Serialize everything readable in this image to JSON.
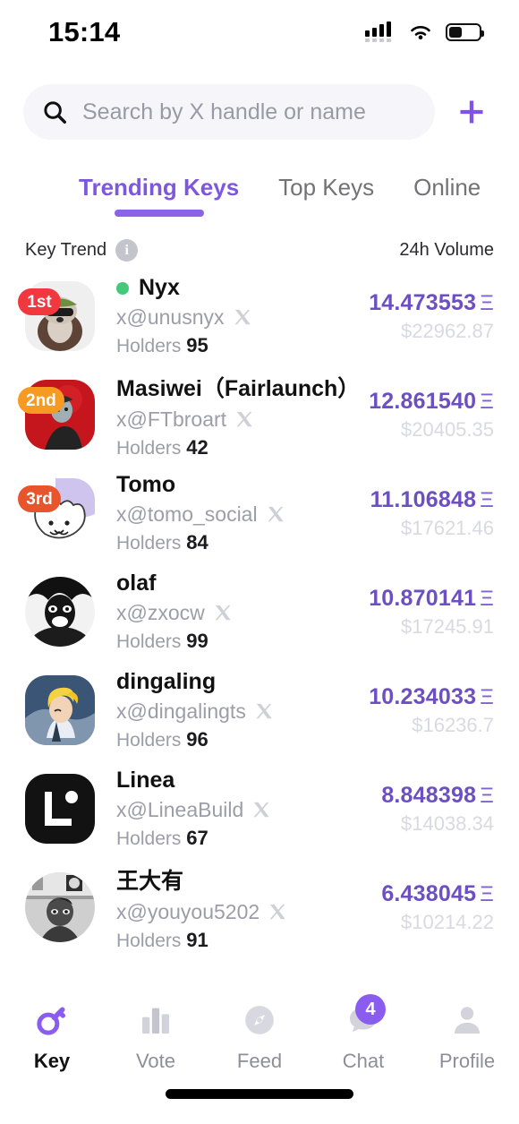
{
  "status_bar": {
    "time": "15:14",
    "cellular_icon": "cellular-signal-icon",
    "wifi_icon": "wifi-icon",
    "battery_icon": "battery-icon",
    "battery_level_pct": 45
  },
  "search": {
    "placeholder": "Search by X handle or name",
    "value": "",
    "icon": "search-icon",
    "add_icon": "plus-icon"
  },
  "tabs": [
    {
      "label": "Trending Keys",
      "active": true
    },
    {
      "label": "Top Keys",
      "active": false
    },
    {
      "label": "Online",
      "active": false
    }
  ],
  "column_headers": {
    "left": "Key Trend",
    "info_icon": "info-icon",
    "right": "24h Volume"
  },
  "colors": {
    "accent_purple": "#8a63e8",
    "value_purple": "#6d4fc4",
    "rank1_red": "#f2383f",
    "rank2_orange": "#f79a22",
    "rank3_orangered": "#e8542c",
    "online_green": "#44c97a",
    "badge_purple": "#8a5cf0",
    "search_bg": "#f5f5fa",
    "muted_grey": "#9d9da8",
    "usd_grey": "#d9d9e2"
  },
  "list": [
    {
      "rank": "1st",
      "rank_color": "#f2383f",
      "name": "Nyx",
      "online": true,
      "handle": "x@unusnyx",
      "holders_label": "Holders",
      "holders": "95",
      "eth": "14.473553",
      "eth_symbol": "Ξ",
      "usd": "$22962.87",
      "avatar_shape": "squircle",
      "avatar": "hedgehog-sunglasses-avatar"
    },
    {
      "rank": "2nd",
      "rank_color": "#f79a22",
      "name": "Masiwei（Fairlaunch）",
      "online": false,
      "handle": "x@FTbroart",
      "holders_label": "Holders",
      "holders": "42",
      "eth": "12.861540",
      "eth_symbol": "Ξ",
      "usd": "$20405.35",
      "avatar_shape": "squircle",
      "avatar": "red-portrait-avatar"
    },
    {
      "rank": "3rd",
      "rank_color": "#e8542c",
      "name": "Tomo",
      "online": false,
      "handle": "x@tomo_social",
      "holders_label": "Holders",
      "holders": "84",
      "eth": "11.106848",
      "eth_symbol": "Ξ",
      "usd": "$17621.46",
      "avatar_shape": "squircle",
      "avatar": "white-cat-lavender-avatar"
    },
    {
      "rank": "",
      "rank_color": "",
      "name": "olaf",
      "online": false,
      "handle": "x@zxocw",
      "holders_label": "Holders",
      "holders": "99",
      "eth": "10.870141",
      "eth_symbol": "Ξ",
      "usd": "$17245.91",
      "avatar_shape": "circle",
      "avatar": "black-white-face-avatar"
    },
    {
      "rank": "",
      "rank_color": "",
      "name": "dingaling",
      "online": false,
      "handle": "x@dingalingts",
      "holders_label": "Holders",
      "holders": "96",
      "eth": "10.234033",
      "eth_symbol": "Ξ",
      "usd": "$16236.7",
      "avatar_shape": "squircle",
      "avatar": "blonde-anime-avatar"
    },
    {
      "rank": "",
      "rank_color": "",
      "name": "Linea",
      "online": false,
      "handle": "x@LineaBuild",
      "holders_label": "Holders",
      "holders": "67",
      "eth": "8.848398",
      "eth_symbol": "Ξ",
      "usd": "$14038.34",
      "avatar_shape": "squircle",
      "avatar": "linea-logo-avatar"
    },
    {
      "rank": "",
      "rank_color": "",
      "name": "王大有",
      "online": false,
      "handle": "x@youyou5202",
      "holders_label": "Holders",
      "holders": "91",
      "eth": "6.438045",
      "eth_symbol": "Ξ",
      "usd": "$10214.22",
      "avatar_shape": "circle",
      "avatar": "bw-photo-avatar"
    }
  ],
  "bottom_nav": [
    {
      "label": "Key",
      "icon": "key-icon",
      "active": true,
      "badge": ""
    },
    {
      "label": "Vote",
      "icon": "bar-chart-icon",
      "active": false,
      "badge": ""
    },
    {
      "label": "Feed",
      "icon": "compass-icon",
      "active": false,
      "badge": ""
    },
    {
      "label": "Chat",
      "icon": "chat-bubble-icon",
      "active": false,
      "badge": "4"
    },
    {
      "label": "Profile",
      "icon": "person-icon",
      "active": false,
      "badge": ""
    }
  ]
}
